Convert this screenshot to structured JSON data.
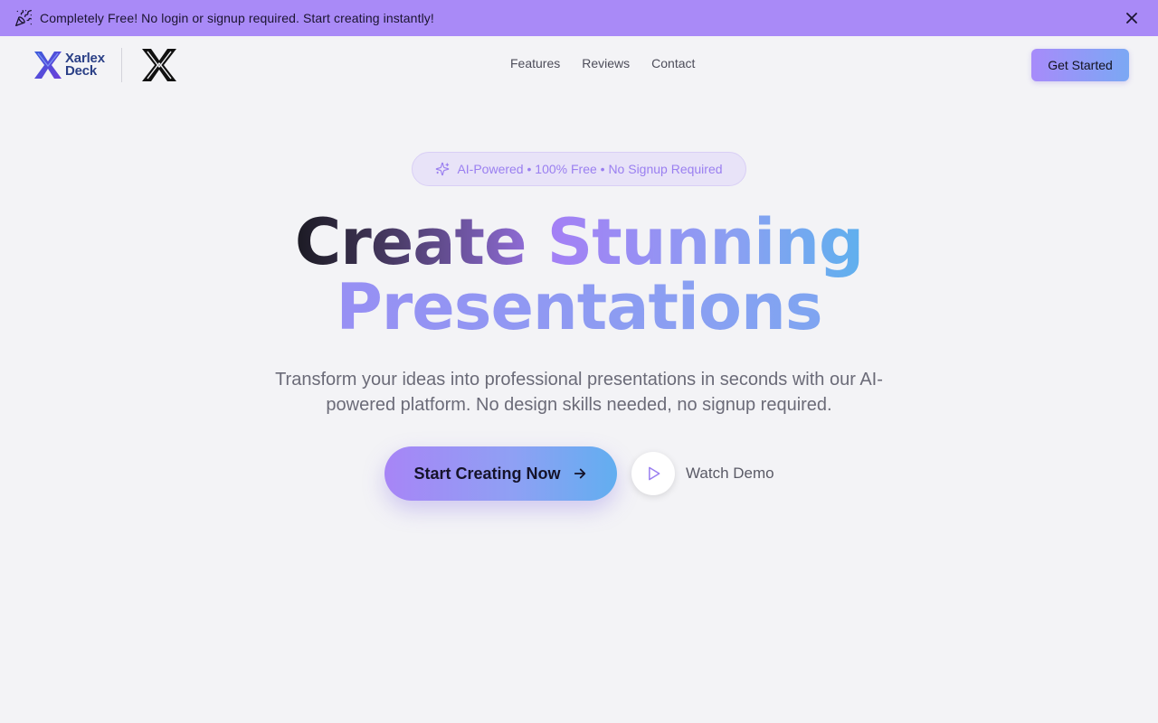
{
  "announcement": {
    "text": "Completely Free! No login or signup required. Start creating instantly!",
    "icon": "party-popper-icon",
    "close_icon": "close-icon"
  },
  "header": {
    "brand_line1": "Xarlex",
    "brand_line2": "Deck",
    "nav": [
      "Features",
      "Reviews",
      "Contact"
    ],
    "cta": "Get Started"
  },
  "hero": {
    "badge": "AI-Powered • 100% Free • No Signup Required",
    "headline_word1": "Create",
    "headline_word2": "Stunning",
    "headline_line2": "Presentations",
    "subtitle": "Transform your ideas into professional presentations in seconds with our AI-powered platform. No design skills needed, no signup required.",
    "primary_cta": "Start Creating Now",
    "secondary_cta": "Watch Demo"
  },
  "colors": {
    "announcement_bg": "#a98af7",
    "page_bg": "#f3f3f6",
    "accent_purple": "#a78bfa",
    "accent_blue": "#60a5fa"
  }
}
